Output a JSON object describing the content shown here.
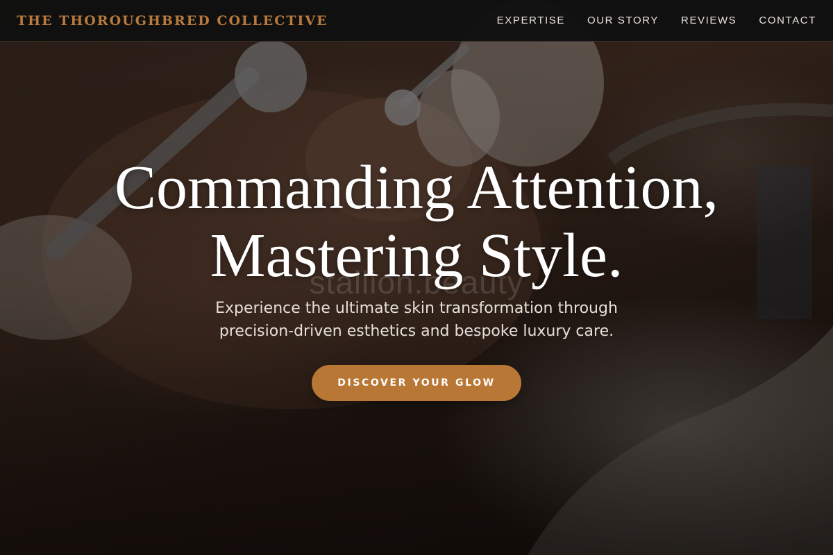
{
  "header": {
    "brand": "THE THOROUGHBRED COLLECTIVE",
    "nav": [
      {
        "label": "EXPERTISE"
      },
      {
        "label": "OUR STORY"
      },
      {
        "label": "REVIEWS"
      },
      {
        "label": "CONTACT"
      }
    ]
  },
  "hero": {
    "title_line1": "Commanding Attention,",
    "title_line2": "Mastering Style.",
    "watermark": "stallion.beauty",
    "subtitle_line1": "Experience the ultimate skin transformation through",
    "subtitle_line2": "precision-driven esthetics and bespoke luxury care.",
    "cta_label": "DISCOVER YOUR GLOW"
  },
  "colors": {
    "accent": "#b97735",
    "brand_text": "#b87a3c",
    "header_bg": "#101010",
    "text_light": "#ffffff"
  }
}
